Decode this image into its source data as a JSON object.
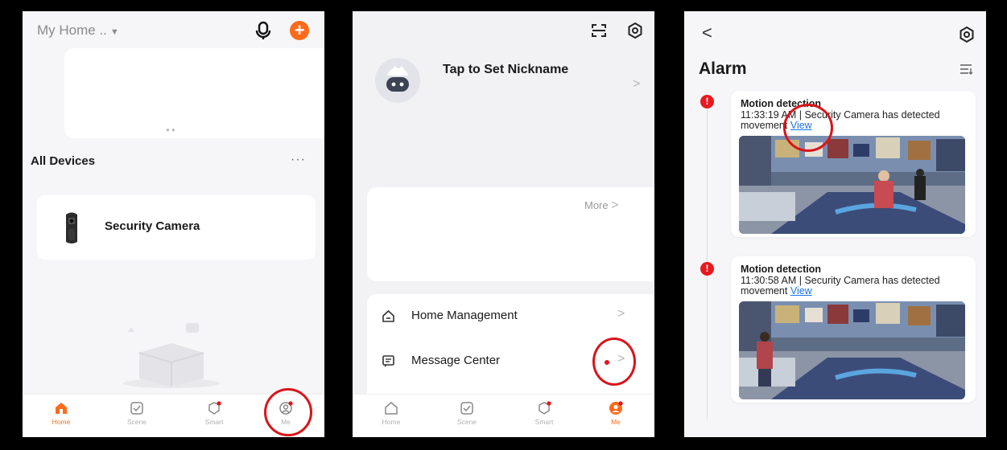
{
  "home_screen": {
    "home_selector": "My Home ..",
    "section_title": "All Devices",
    "more_label": "···",
    "device": {
      "name": "Security Camera"
    },
    "tabs": [
      {
        "label": "Home",
        "active": true
      },
      {
        "label": "Scene",
        "active": false
      },
      {
        "label": "Smart",
        "active": false
      },
      {
        "label": "Me",
        "active": false
      }
    ]
  },
  "me_screen": {
    "nickname_prompt": "Tap to Set Nickname",
    "more_link": "More",
    "menu": [
      {
        "label": "Home Management",
        "icon": "house-icon"
      },
      {
        "label": "Message Center",
        "icon": "message-icon",
        "has_unread_dot": true
      }
    ],
    "tabs": [
      {
        "label": "Home",
        "active": false
      },
      {
        "label": "Scene",
        "active": false
      },
      {
        "label": "Smart",
        "active": false
      },
      {
        "label": "Me",
        "active": true
      }
    ]
  },
  "alarm_screen": {
    "title": "Alarm",
    "events": [
      {
        "title": "Motion detection",
        "description": "11:33:19 AM | Security Camera has detected movement",
        "link": "View"
      },
      {
        "title": "Motion detection",
        "description": "11:30:58 AM | Security Camera has detected movement",
        "link": "View"
      }
    ]
  },
  "colors": {
    "accent": "#ff6a1a",
    "alert_red": "#e81a1f",
    "highlight_circle": "#d9141a",
    "link_blue": "#1a73e8"
  }
}
